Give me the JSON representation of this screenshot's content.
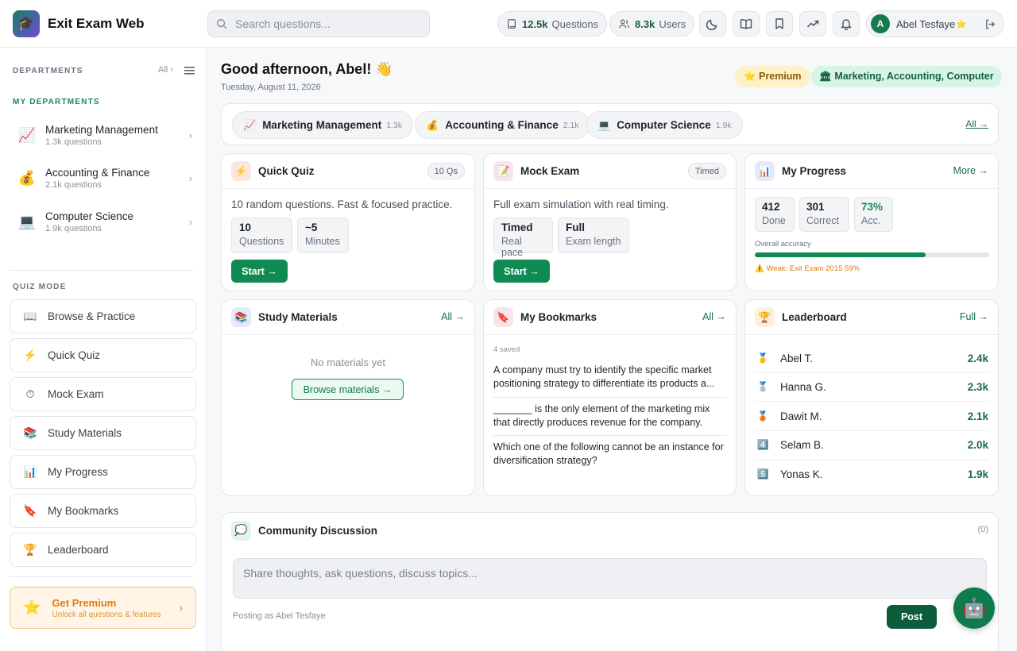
{
  "app": {
    "title": "Exit Exam Web",
    "logo_icon": "graduation-cap-icon",
    "accent": "#108a54"
  },
  "search": {
    "placeholder": "Search questions..."
  },
  "header_stats": {
    "questions_count": "12.5k",
    "questions_label": "Questions",
    "users_count": "8.3k",
    "users_label": "Users"
  },
  "user": {
    "initial": "A",
    "name": "Abel Tesfaye",
    "premium_icon": "star-icon"
  },
  "sidebar": {
    "departments_heading": "DEPARTMENTS",
    "all_label": "All ›",
    "my_departments_heading": "MY DEPARTMENTS",
    "departments": [
      {
        "emoji": "📈",
        "name": "Marketing Management",
        "count": "1.3k questions"
      },
      {
        "emoji": "💰",
        "name": "Accounting & Finance",
        "count": "2.1k questions"
      },
      {
        "emoji": "💻",
        "name": "Computer Science",
        "count": "1.9k questions"
      }
    ],
    "quiz_mode_heading": "QUIZ MODE",
    "quiz_modes": [
      {
        "emoji": "📖",
        "label": "Browse & Practice"
      },
      {
        "emoji": "⚡",
        "label": "Quick Quiz"
      },
      {
        "emoji": "⏱",
        "label": "Mock Exam"
      },
      {
        "emoji": "📚",
        "label": "Study Materials"
      },
      {
        "emoji": "📊",
        "label": "My Progress"
      },
      {
        "emoji": "🔖",
        "label": "My Bookmarks"
      },
      {
        "emoji": "🏆",
        "label": "Leaderboard"
      }
    ],
    "premium": {
      "emoji": "⭐",
      "title": "Get Premium",
      "subtitle": "Unlock all questions & features",
      "chevron": "›"
    }
  },
  "main": {
    "greeting": "Good afternoon, Abel! 👋",
    "date": "Tuesday, August 11, 2026",
    "premium_badge": "⭐ Premium",
    "departments_badge": "🏛 Marketing, Accounting, Computer",
    "dept_chips": [
      {
        "emoji": "📈",
        "name": "Marketing Management",
        "count": "1.3k"
      },
      {
        "emoji": "💰",
        "name": "Accounting & Finance",
        "count": "2.1k"
      },
      {
        "emoji": "💻",
        "name": "Computer Science",
        "count": "1.9k"
      }
    ],
    "dept_all": "All →"
  },
  "quick_quiz": {
    "icon": "⚡",
    "title": "Quick Quiz",
    "tag": "10 Qs",
    "desc": "10 random questions. Fast & focused practice.",
    "stats": [
      {
        "value": "10",
        "label": "Questions"
      },
      {
        "value": "~5",
        "label": "Minutes"
      }
    ],
    "button": "Start →"
  },
  "mock_exam": {
    "icon": "📝",
    "title": "Mock Exam",
    "tag": "Timed",
    "desc": "Full exam simulation with real timing.",
    "stats": [
      {
        "value": "Timed",
        "label": "Real pace"
      },
      {
        "value": "Full",
        "label": "Exam length"
      }
    ],
    "button": "Start →"
  },
  "progress": {
    "icon": "📊",
    "title": "My Progress",
    "link": "More →",
    "stats": [
      {
        "value": "412",
        "label": "Done"
      },
      {
        "value": "301",
        "label": "Correct"
      },
      {
        "value": "73%",
        "label": "Acc."
      }
    ],
    "accuracy_label": "Overall accuracy",
    "accuracy_fraction": 0.73,
    "weak": "⚠️ Weak: Exit Exam 2015 59%"
  },
  "study_materials": {
    "icon": "📚",
    "title": "Study Materials",
    "link": "All →",
    "empty": "No materials yet",
    "button": "Browse materials →"
  },
  "bookmarks": {
    "icon": "🔖",
    "title": "My Bookmarks",
    "link": "All →",
    "saved": "4 saved",
    "items": [
      "A company must try to identify the specific market positioning strategy to differentiate its products a...",
      "_______ is the only element of the marketing mix that directly produces revenue for the company.",
      "Which one of the following cannot be an instance for diversification strategy?"
    ]
  },
  "leaderboard": {
    "icon": "🏆",
    "title": "Leaderboard",
    "link": "Full →",
    "rows": [
      {
        "medal": "🥇",
        "name": "Abel T.",
        "score": "2.4k"
      },
      {
        "medal": "🥈",
        "name": "Hanna G.",
        "score": "2.3k"
      },
      {
        "medal": "🥉",
        "name": "Dawit M.",
        "score": "2.1k"
      },
      {
        "medal": "4️⃣",
        "name": "Selam B.",
        "score": "2.0k"
      },
      {
        "medal": "5️⃣",
        "name": "Yonas K.",
        "score": "1.9k"
      }
    ]
  },
  "discussion": {
    "icon": "💭",
    "title": "Community Discussion",
    "count": "(0)",
    "placeholder": "Share thoughts, ask questions, discuss topics...",
    "posting_as": "Posting as Abel Tesfaye",
    "post_button": "Post"
  },
  "assistant": {
    "icon": "robot-icon",
    "emoji": "🤖"
  }
}
